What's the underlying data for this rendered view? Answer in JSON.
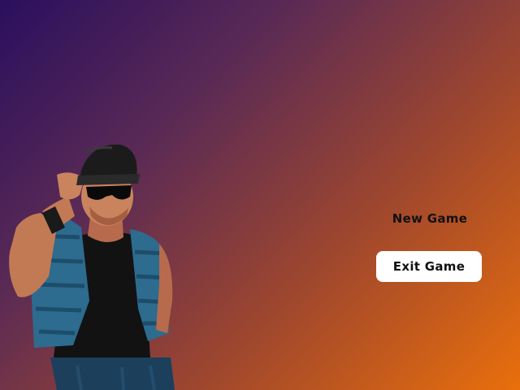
{
  "menu": {
    "new_game_label": "New Game",
    "exit_game_label": "Exit Game",
    "selected": "Exit Game"
  },
  "colors": {
    "background_top_left": "#2a0f5e",
    "background_bottom_right": "#e96f0c",
    "menu_text": "#111111",
    "selected_highlight": "#ffffff"
  }
}
